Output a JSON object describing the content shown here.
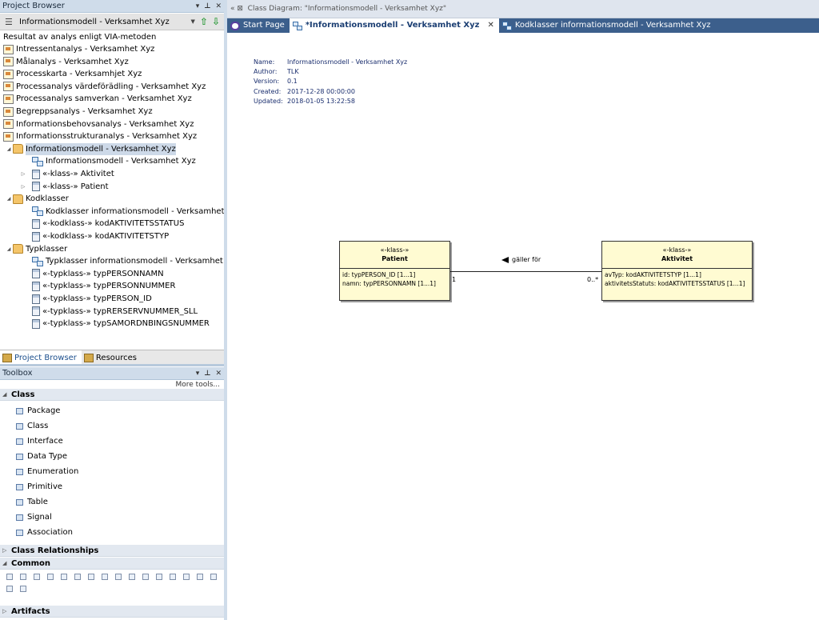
{
  "project_browser": {
    "title": "Project Browser",
    "selector": "Informationsmodell - Verksamhet Xyz",
    "tree": [
      {
        "label": "Resultat av analys enligt VIA-metoden",
        "icon": "none"
      },
      {
        "label": "Intressentanalys - Verksamhet Xyz",
        "icon": "diagram-icon"
      },
      {
        "label": "Målanalys - Verksamhet Xyz",
        "icon": "diagram-icon"
      },
      {
        "label": "Processkarta - Verksamhjet Xyz",
        "icon": "diagram-icon"
      },
      {
        "label": "Processanalys värdeförädling - Verksamhet Xyz",
        "icon": "diagram-icon"
      },
      {
        "label": "Processanalys samverkan - Verksamhet Xyz",
        "icon": "diagram-icon"
      },
      {
        "label": "Begreppsanalys - Verksamhet Xyz",
        "icon": "diagram-icon"
      },
      {
        "label": "Informationsbehovsanalys - Verksamhet Xyz",
        "icon": "diagram-icon"
      },
      {
        "label": "Informationsstrukturanalys - Verksamhet Xyz",
        "icon": "diagram-icon"
      },
      {
        "label": "Informationsmodell - Verksamhet Xyz",
        "icon": "folder-icon"
      },
      {
        "label": "Informationsmodell - Verksamhet Xyz",
        "icon": "class-diagram-icon"
      },
      {
        "label": "«-klass-» Aktivitet",
        "icon": "class-icon"
      },
      {
        "label": "«-klass-» Patient",
        "icon": "class-icon"
      },
      {
        "label": "Kodklasser",
        "icon": "folder-icon"
      },
      {
        "label": "Kodklasser informationsmodell - Verksamhet Xyz",
        "icon": "class-diagram-icon"
      },
      {
        "label": "«-kodklass-» kodAKTIVITETSSTATUS",
        "icon": "class-icon"
      },
      {
        "label": "«-kodklass-» kodAKTIVITETSTYP",
        "icon": "class-icon"
      },
      {
        "label": "Typklasser",
        "icon": "folder-icon"
      },
      {
        "label": "Typklasser informationsmodell - Verksamhet Xyz",
        "icon": "class-diagram-icon"
      },
      {
        "label": "«-typklass-» typPERSONNAMN",
        "icon": "class-icon"
      },
      {
        "label": "«-typklass-» typPERSONNUMMER",
        "icon": "class-icon"
      },
      {
        "label": "«-typklass-» typPERSON_ID",
        "icon": "class-icon"
      },
      {
        "label": "«-typklass-» typRERSERVNUMMER_SLL",
        "icon": "class-icon"
      },
      {
        "label": "«-typklass-» typSAMORDNBINGSNUMMER",
        "icon": "class-icon"
      }
    ],
    "tabs": [
      "Project Browser",
      "Resources"
    ]
  },
  "toolbox": {
    "title": "Toolbox",
    "more_tools": "More tools...",
    "class_section": "Class",
    "class_items": [
      "Package",
      "Class",
      "Interface",
      "Data Type",
      "Enumeration",
      "Primitive",
      "Table",
      "Signal",
      "Association"
    ],
    "relationships_section": "Class Relationships",
    "common_section": "Common",
    "artifacts_section": "Artifacts"
  },
  "document": {
    "header": "Class Diagram: \"Informationsmodell - Verksamhet Xyz\"",
    "tabs": [
      {
        "label": "Start Page"
      },
      {
        "label": "*Informationsmodell - Verksamhet Xyz"
      },
      {
        "label": "Kodklasser informationsmodell - Verksamhet Xyz"
      }
    ]
  },
  "diagram": {
    "props": [
      {
        "k": "Name:",
        "v": "Informationsmodell - Verksamhet Xyz"
      },
      {
        "k": "Author:",
        "v": "TLK"
      },
      {
        "k": "Version:",
        "v": "0.1"
      },
      {
        "k": "Created:",
        "v": "2017-12-28 00:00:00"
      },
      {
        "k": "Updated:",
        "v": "2018-01-05 13:22:58"
      }
    ],
    "patient": {
      "stereotype": "«-klass-»",
      "name": "Patient",
      "attrs": [
        "id: typPERSON_ID [1...1]",
        "namn: typPERSONNAMN [1...1]"
      ]
    },
    "aktivitet": {
      "stereotype": "«-klass-»",
      "name": "Aktivitet",
      "attrs": [
        "avTyp: kodAKTIVITETSTYP [1...1]",
        "aktivitetsStatuts: kodAKTIVITETSSTATUS [1...1]"
      ]
    },
    "association": {
      "label": "gäller för",
      "source_mult": "1",
      "target_mult": "0..*"
    }
  }
}
